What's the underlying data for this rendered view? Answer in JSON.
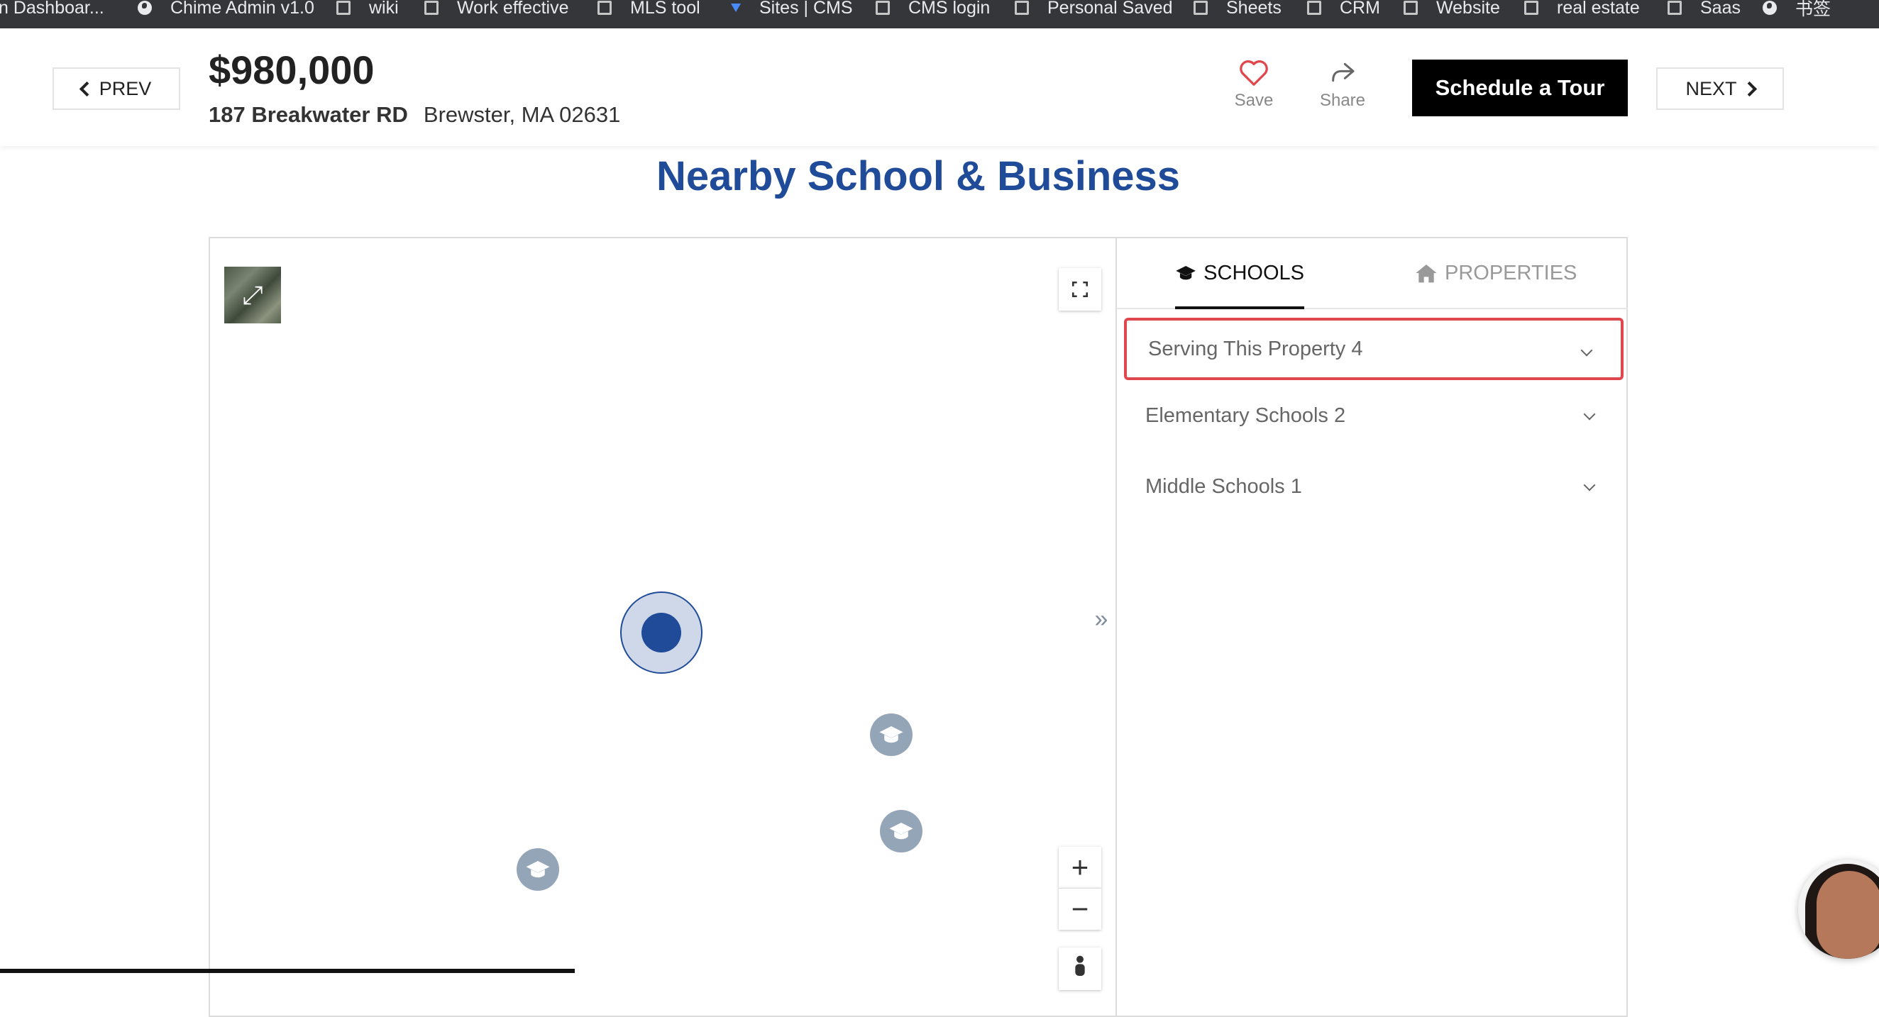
{
  "bookmarks": [
    {
      "label": "n Dashboar...",
      "icon": "none"
    },
    {
      "label": "Chime Admin v1.0",
      "icon": "globe-icon"
    },
    {
      "label": "wiki",
      "icon": "folder-icon"
    },
    {
      "label": "Work effective",
      "icon": "folder-icon"
    },
    {
      "label": "MLS tool",
      "icon": "folder-icon"
    },
    {
      "label": "Sites | CMS",
      "icon": "pin-icon"
    },
    {
      "label": "CMS login",
      "icon": "folder-icon"
    },
    {
      "label": "Personal Saved",
      "icon": "folder-icon"
    },
    {
      "label": "Sheets",
      "icon": "folder-icon"
    },
    {
      "label": "CRM",
      "icon": "folder-icon"
    },
    {
      "label": "Website",
      "icon": "folder-icon"
    },
    {
      "label": "real estate",
      "icon": "folder-icon"
    },
    {
      "label": "Saas",
      "icon": "folder-icon"
    },
    {
      "label": "书签",
      "icon": "globe-icon"
    }
  ],
  "header": {
    "prev_label": "PREV",
    "next_label": "NEXT",
    "price": "$980,000",
    "street": "187 Breakwater RD",
    "city": "Brewster, MA 02631",
    "save_label": "Save",
    "share_label": "Share",
    "tour_label": "Schedule a Tour"
  },
  "section_title": "Nearby School & Business",
  "panel": {
    "tabs": [
      {
        "label": "SCHOOLS",
        "icon": "graduation-cap-icon",
        "active": true
      },
      {
        "label": "PROPERTIES",
        "icon": "home-icon",
        "active": false
      }
    ],
    "groups": [
      {
        "label": "Serving This Property 4",
        "highlighted": true
      },
      {
        "label": "Elementary Schools 2",
        "highlighted": false
      },
      {
        "label": "Middle Schools 1",
        "highlighted": false
      }
    ]
  },
  "map": {
    "zoom_in_label": "+",
    "zoom_out_label": "−",
    "collapse_label": "»"
  },
  "colors": {
    "accent_blue": "#1f4b99",
    "highlight_red": "#e0474c",
    "school_pin": "#95a5b8",
    "bookmarks_bg": "#35363a"
  }
}
